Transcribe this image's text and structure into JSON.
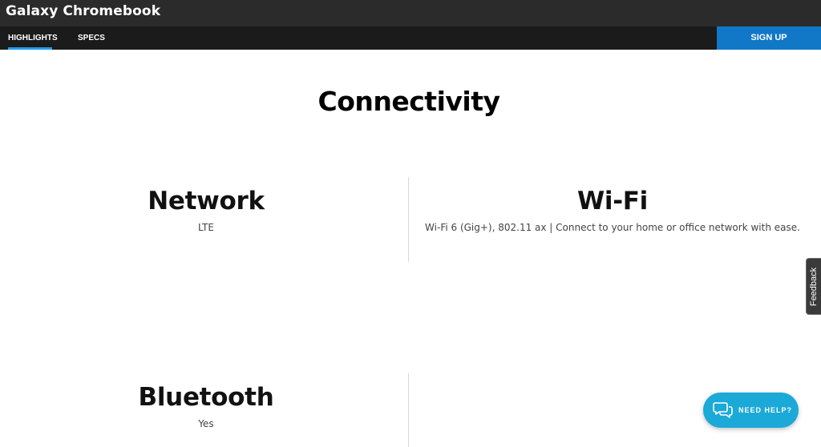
{
  "header": {
    "brand": "Galaxy Chromebook"
  },
  "nav": {
    "tabs": [
      {
        "label": "HIGHLIGHTS",
        "active": true
      },
      {
        "label": "SPECS",
        "active": false
      }
    ],
    "signup_label": "SIGN UP"
  },
  "section": {
    "title": "Connectivity"
  },
  "specs": {
    "network": {
      "heading": "Network",
      "value": "LTE"
    },
    "wifi": {
      "heading": "Wi-Fi",
      "value": "Wi-Fi 6 (Gig+), 802.11 ax | Connect to your home or office network with ease."
    },
    "bluetooth": {
      "heading": "Bluetooth",
      "value": "Yes"
    }
  },
  "feedback": {
    "label": "Feedback"
  },
  "help": {
    "label": "NEED HELP?",
    "icon": "chat-bubbles-icon"
  },
  "colors": {
    "topbar": "#2b2b2b",
    "navbar": "#1b1b1b",
    "nav_active_underline": "#1f9ef0",
    "signup": "#1078c7",
    "help_button": "#1ba9d8"
  }
}
